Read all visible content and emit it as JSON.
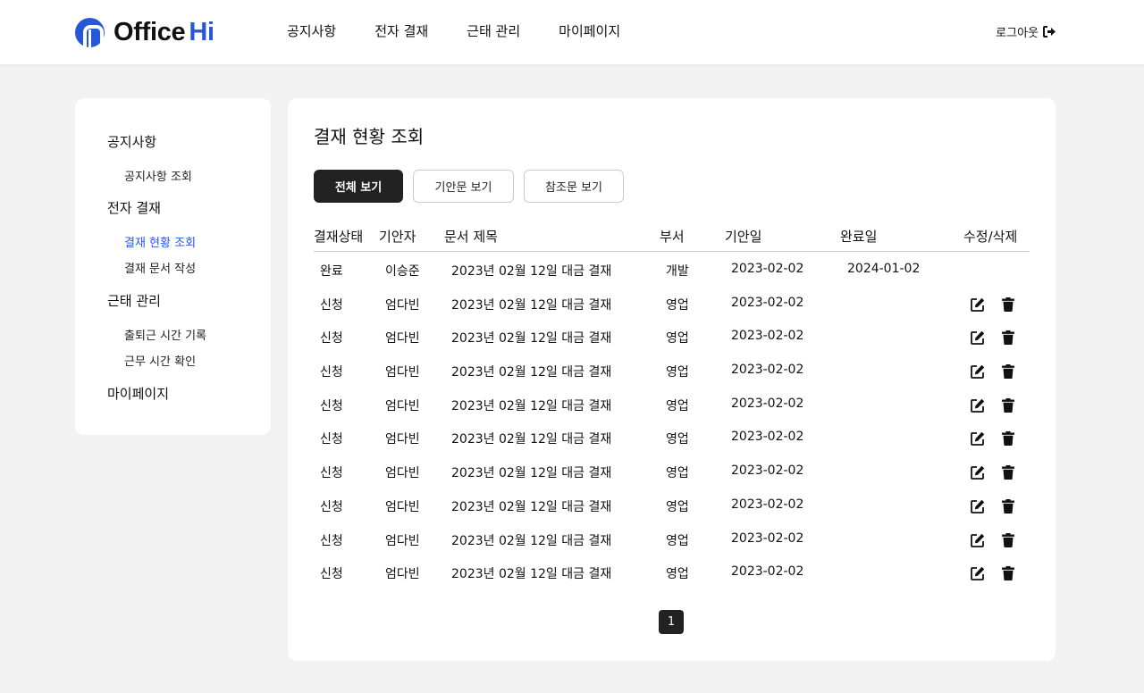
{
  "brand": {
    "name": "Office",
    "accent_text": "Hi",
    "accent_color": "#2557d6"
  },
  "topnav": [
    "공지사항",
    "전자 결재",
    "근태 관리",
    "마이페이지"
  ],
  "logout_label": "로그아웃",
  "sidebar": {
    "sections": [
      {
        "title": "공지사항",
        "items": [
          "공지사항 조회"
        ]
      },
      {
        "title": "전자 결재",
        "items": [
          "결재 현황 조회",
          "결재 문서 작성"
        ]
      },
      {
        "title": "근태 관리",
        "items": [
          "출퇴근 시간 기록",
          "근무 시간 확인"
        ]
      },
      {
        "title": "마이페이지",
        "items": []
      }
    ],
    "active_item": "결재 현황 조회"
  },
  "main": {
    "title": "결재 현황 조회",
    "filters": [
      "전체 보기",
      "기안문 보기",
      "참조문 보기"
    ],
    "active_filter": "전체 보기",
    "table": {
      "columns": [
        "결재상태",
        "기안자",
        "문서 제목",
        "부서",
        "기안일",
        "완료일",
        "수정/삭제"
      ],
      "rows": [
        {
          "status": "완료",
          "drafter": "이승준",
          "title": "2023년 02월 12일 대금 결재",
          "dept": "개발",
          "draft_date": "2023-02-02",
          "done_date": "2024-01-02",
          "editable": false
        },
        {
          "status": "신청",
          "drafter": "엄다빈",
          "title": "2023년 02월 12일 대금 결재",
          "dept": "영업",
          "draft_date": "2023-02-02",
          "done_date": "",
          "editable": true
        },
        {
          "status": "신청",
          "drafter": "엄다빈",
          "title": "2023년 02월 12일 대금 결재",
          "dept": "영업",
          "draft_date": "2023-02-02",
          "done_date": "",
          "editable": true
        },
        {
          "status": "신청",
          "drafter": "엄다빈",
          "title": "2023년 02월 12일 대금 결재",
          "dept": "영업",
          "draft_date": "2023-02-02",
          "done_date": "",
          "editable": true
        },
        {
          "status": "신청",
          "drafter": "엄다빈",
          "title": "2023년 02월 12일 대금 결재",
          "dept": "영업",
          "draft_date": "2023-02-02",
          "done_date": "",
          "editable": true
        },
        {
          "status": "신청",
          "drafter": "엄다빈",
          "title": "2023년 02월 12일 대금 결재",
          "dept": "영업",
          "draft_date": "2023-02-02",
          "done_date": "",
          "editable": true
        },
        {
          "status": "신청",
          "drafter": "엄다빈",
          "title": "2023년 02월 12일 대금 결재",
          "dept": "영업",
          "draft_date": "2023-02-02",
          "done_date": "",
          "editable": true
        },
        {
          "status": "신청",
          "drafter": "엄다빈",
          "title": "2023년 02월 12일 대금 결재",
          "dept": "영업",
          "draft_date": "2023-02-02",
          "done_date": "",
          "editable": true
        },
        {
          "status": "신청",
          "drafter": "엄다빈",
          "title": "2023년 02월 12일 대금 결재",
          "dept": "영업",
          "draft_date": "2023-02-02",
          "done_date": "",
          "editable": true
        },
        {
          "status": "신청",
          "drafter": "엄다빈",
          "title": "2023년 02월 12일 대금 결재",
          "dept": "영업",
          "draft_date": "2023-02-02",
          "done_date": "",
          "editable": true
        }
      ]
    },
    "pagination": {
      "pages": [
        "1"
      ],
      "current": "1"
    }
  }
}
